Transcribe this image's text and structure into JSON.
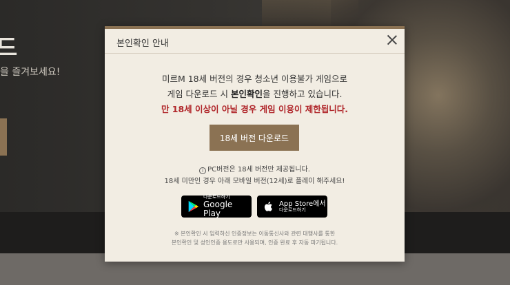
{
  "background": {
    "title": "드",
    "subtitle": "을 즐겨보세요!"
  },
  "modal": {
    "title": "본인확인 안내",
    "message_line1": "미르M 18세 버전의 경우 청소년 이용불가 게임으로",
    "message_line2_prefix": "게임 다운로드 시 ",
    "message_line2_bold": "본인확인",
    "message_line2_suffix": "을 진행하고 있습니다.",
    "message_warning": "만 18세 이상이 아닐 경우 게임 이용이 제한됩니다.",
    "download_button": "18세 버전 다운로드",
    "note_icon": "i",
    "note_line1": "PC버전은 18세 버전만 제공됩니다.",
    "note_line2": "18세 미만인 경우 아래 모바일 버전(12세)로 플레이 해주세요!",
    "google_small": "다운로드하기",
    "google_big": "Google Play",
    "apple_big": "App Store에서",
    "apple_small": "다운로드하기",
    "footnote_line1": "※ 본인확인 시 입력하신 인증정보는 이동통신사와 관련 대행사를 통한",
    "footnote_line2": "본인확인 및 성인인증 용도로만 사용되며, 인증 완료 후 자동 파기됩니다."
  },
  "colors": {
    "accent": "#8b7253",
    "warning": "#b0262a",
    "modal_bg": "#f2ede3"
  }
}
